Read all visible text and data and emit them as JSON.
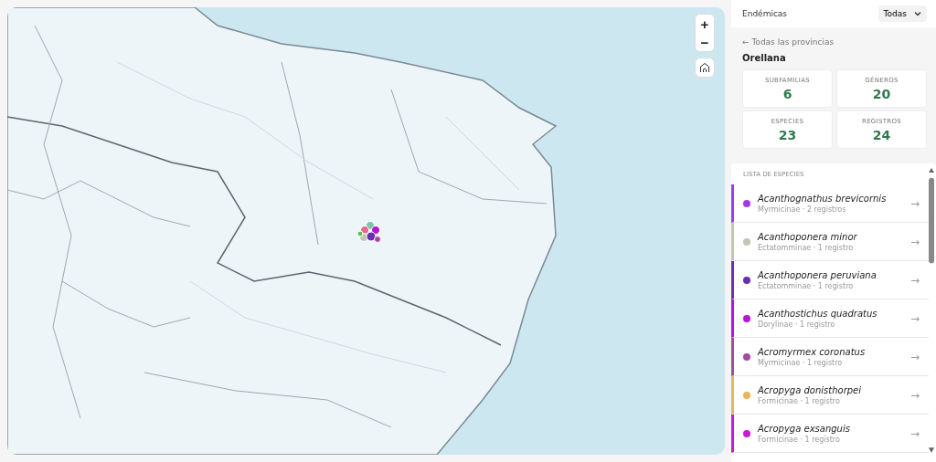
{
  "map": {
    "zoom_in": "+",
    "zoom_out": "−"
  },
  "filter": {
    "label": "Endémicas",
    "select": "Todas"
  },
  "back_link": {
    "arrow": "←",
    "label": "Todas las provincias"
  },
  "province": "Orellana",
  "stats": [
    {
      "label": "SUBFAMILIAS",
      "value": "6"
    },
    {
      "label": "GÉNEROS",
      "value": "20"
    },
    {
      "label": "ESPECIES",
      "value": "23"
    },
    {
      "label": "REGISTROS",
      "value": "24"
    }
  ],
  "species_list": {
    "title": "LISTA DE ESPECIES",
    "items": [
      {
        "name": "Acanthognathus brevicornis",
        "detail": "Myrmicinae · 2 registros",
        "color": "#a23be0",
        "arrow": "→"
      },
      {
        "name": "Acanthoponera minor",
        "detail": "Ectatomminae · 1 registro",
        "color": "#c4c5b2",
        "arrow": "→"
      },
      {
        "name": "Acanthoponera peruviana",
        "detail": "Ectatomminae · 1 registro",
        "color": "#6a2fb0",
        "arrow": "→"
      },
      {
        "name": "Acanthostichus quadratus",
        "detail": "Dorylinae · 1 registro",
        "color": "#b515d8",
        "arrow": "→"
      },
      {
        "name": "Acromyrmex coronatus",
        "detail": "Myrmicinae · 1 registro",
        "color": "#a54aa0",
        "arrow": "→"
      },
      {
        "name": "Acropyga donisthorpei",
        "detail": "Formicinae · 1 registro",
        "color": "#e9b45a",
        "arrow": "→"
      },
      {
        "name": "Acropyga exsanguis",
        "detail": "Formicinae · 1 registro",
        "color": "#c61ad6",
        "arrow": "→"
      }
    ]
  }
}
